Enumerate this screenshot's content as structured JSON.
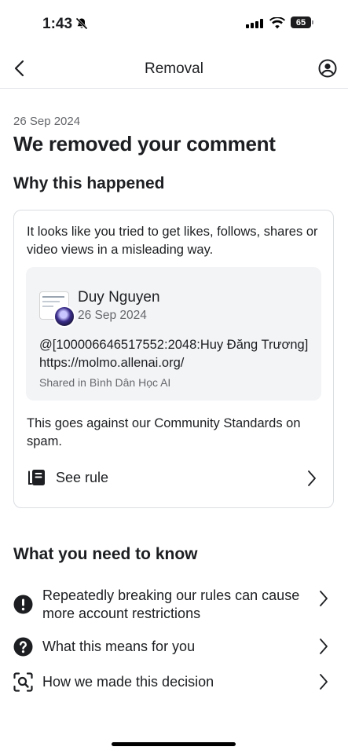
{
  "status_bar": {
    "time": "1:43",
    "battery_level": "65"
  },
  "header": {
    "title": "Removal"
  },
  "main": {
    "date": "26 Sep 2024",
    "headline": "We removed your comment",
    "why_heading": "Why this happened",
    "reason": "It looks like you tried to get likes, follows, shares or video views in a misleading way.",
    "post": {
      "author": "Duy Nguyen",
      "date": "26 Sep 2024",
      "comment_text": "@[100006646517552:2048:Huy Đăng Trương] https://molmo.allenai.org/",
      "shared_in": "Shared in Bình Dân Học AI"
    },
    "standards_text": "This goes against our Community Standards on spam.",
    "see_rule_label": "See rule",
    "know_heading": "What you need to know",
    "know_items": [
      {
        "label": "Repeatedly breaking our rules can cause more account restrictions",
        "icon": "exclamation-circle-icon"
      },
      {
        "label": "What this means for you",
        "icon": "question-circle-icon"
      },
      {
        "label": "How we made this decision",
        "icon": "search-scan-icon"
      }
    ]
  },
  "colors": {
    "text": "#1c1e21",
    "secondary": "#65676b",
    "border": "#dadde1",
    "post_bg": "#f3f4f6"
  }
}
